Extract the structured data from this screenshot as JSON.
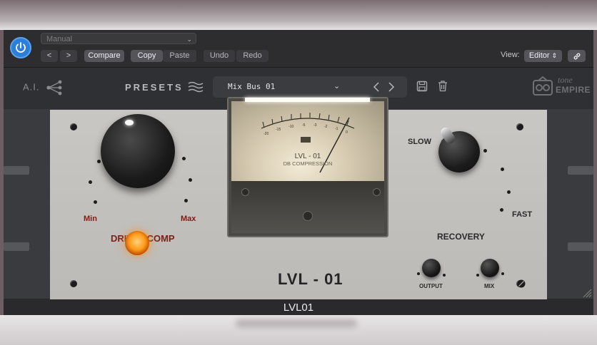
{
  "header": {
    "preset_select": "Manual",
    "prev_label": "<",
    "next_label": ">",
    "compare_label": "Compare",
    "copy_label": "Copy",
    "paste_label": "Paste",
    "undo_label": "Undo",
    "redo_label": "Redo",
    "view_label": "View:",
    "view_value": "Editor"
  },
  "plugin": {
    "ai_label": "A.I.",
    "presets_label": "PRESETS",
    "preset_name": "Mix Bus 01",
    "brand_top": "tone",
    "brand_bottom": "EMPIRE"
  },
  "faceplate": {
    "min_label": "Min",
    "max_label": "Max",
    "drive_label": "DRIVE / COMP",
    "slow_label": "SLOW",
    "fast_label": "FAST",
    "recovery_label": "RECOVERY",
    "output_label": "OUTPUT",
    "mix_label": "MIX",
    "unit_name": "LVL - 01",
    "meter_model": "LVL - 01",
    "meter_subtitle": "DB COMPRESSION",
    "meter_scale": [
      "-20",
      "-15",
      "-10",
      "-5",
      "-3",
      "-2",
      "-1",
      "0"
    ]
  },
  "footer": {
    "plugin_title": "LVL01"
  }
}
